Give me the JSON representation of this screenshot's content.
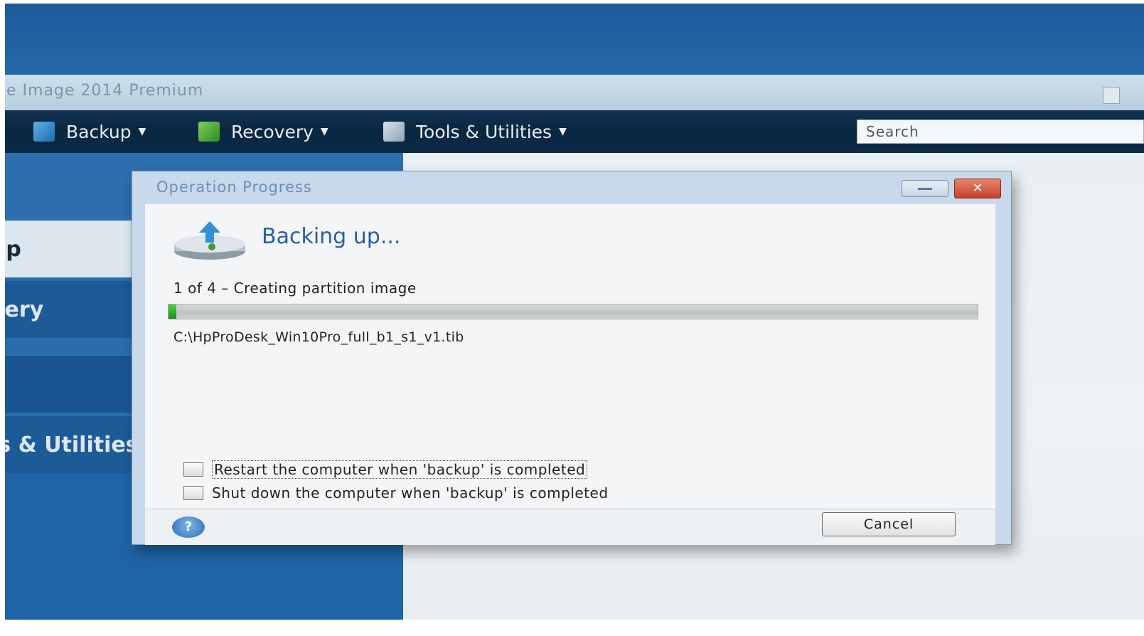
{
  "app": {
    "title": "e Image 2014 Premium"
  },
  "menu": {
    "items": [
      {
        "label": "Backup",
        "icon": "backup-icon"
      },
      {
        "label": "Recovery",
        "icon": "recovery-icon"
      },
      {
        "label": "Tools & Utilities",
        "icon": "tools-icon"
      }
    ],
    "search_placeholder": "Search"
  },
  "sidebar": {
    "items": [
      {
        "label": "up"
      },
      {
        "label": "very"
      },
      {
        "label": "ls & Utilities"
      }
    ]
  },
  "dialog": {
    "title": "Operation Progress",
    "heading": "Backing up...",
    "step": "1 of 4 – Creating partition image",
    "progress": 0.01,
    "file_path": "C:\\HpProDesk_Win10Pro_full_b1_s1_v1.tib",
    "restart_label": "Restart the computer when 'backup' is completed",
    "shutdown_label": "Shut down the computer when 'backup' is completed",
    "cancel_label": "Cancel",
    "close_glyph": "✕",
    "help_glyph": "?"
  },
  "colors": {
    "accent": "#2a5ea8",
    "progress_fill": "#2ca82a",
    "close_button": "#c5402a"
  }
}
